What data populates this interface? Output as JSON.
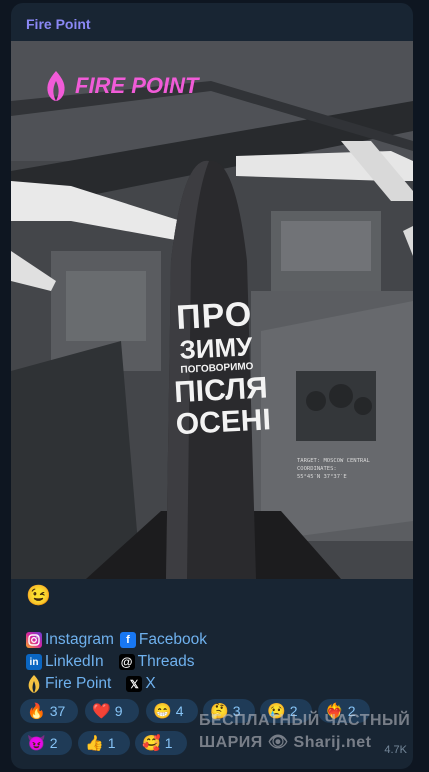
{
  "channel": {
    "name": "Fire Point"
  },
  "poster": {
    "logo_text": "FIRE POINT",
    "headline": [
      "ПРО",
      "ЗИМУ",
      "ПОГОВОРИМО",
      "ПІСЛЯ",
      "ОСЕНІ"
    ],
    "target_line1": "TARGET: MOSCOW CENTRAL",
    "target_line2": "COORDINATES:",
    "target_line3": "55°45′N 37°37′E"
  },
  "message": {
    "emoji": "😉",
    "links": [
      {
        "label": "Instagram",
        "icon": "instagram-icon",
        "color": "#d6249f"
      },
      {
        "label": "Facebook",
        "icon": "facebook-icon",
        "color": "#1877f2"
      },
      {
        "label": "LinkedIn",
        "icon": "linkedin-icon",
        "color": "#0a66c2"
      },
      {
        "label": "Threads",
        "icon": "threads-icon",
        "color": "#ffffff"
      },
      {
        "label": "Fire Point",
        "icon": "fire-point-icon",
        "color": "#f5c242"
      },
      {
        "label": "X",
        "icon": "x-icon",
        "color": "#ffffff"
      }
    ]
  },
  "reactions": [
    {
      "emoji": "🔥",
      "count": "37"
    },
    {
      "emoji": "❤️",
      "count": "9"
    },
    {
      "emoji": "😁",
      "count": "4"
    },
    {
      "emoji": "🤔",
      "count": "3"
    },
    {
      "emoji": "😢",
      "count": "2"
    },
    {
      "emoji": "❤️‍🔥",
      "count": "2"
    },
    {
      "emoji": "😈",
      "count": "2"
    },
    {
      "emoji": "👍",
      "count": "1"
    },
    {
      "emoji": "🥰",
      "count": "1"
    }
  ],
  "watermark": {
    "line1": "БЕСПЛАТНЫЙ ЧАСТНЫЙ",
    "line2": "ШАРИЯ",
    "line3": "Sharij.net"
  },
  "view_count": "4.7K"
}
